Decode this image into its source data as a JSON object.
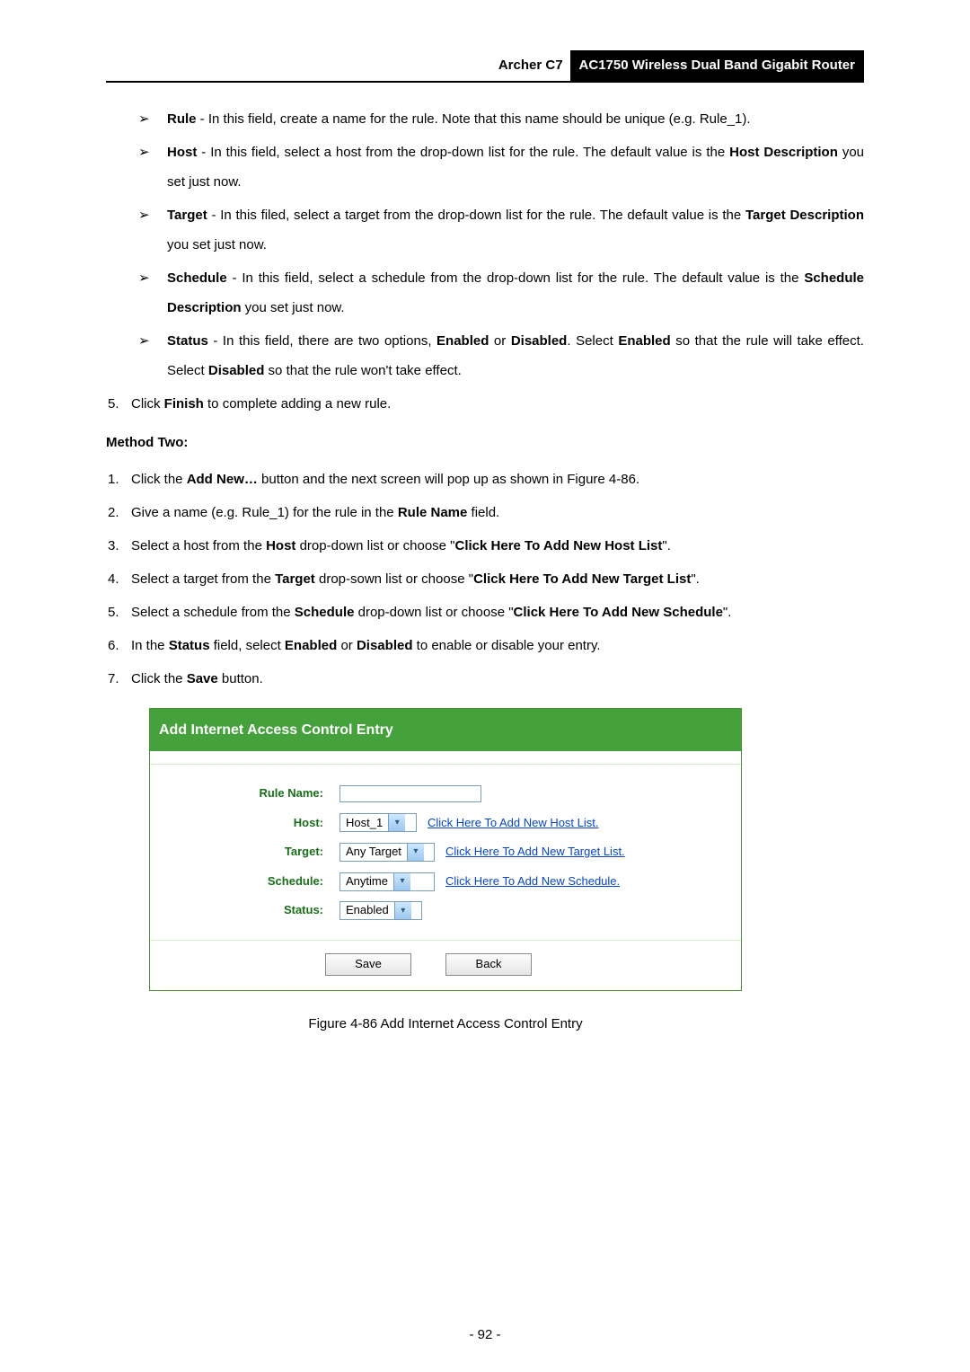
{
  "header": {
    "model": "Archer C7",
    "product": "AC1750 Wireless Dual Band Gigabit Router"
  },
  "bullets": {
    "rule_prefix": "Rule",
    "rule_rest": " - In this field, create a name for the rule. Note that this name should be unique (e.g. Rule_1).",
    "host_prefix": "Host",
    "host_mid1": " - In this field, select a host from the drop-down list for the rule. The default value is the ",
    "host_bold": "Host Description",
    "host_end": " you set just now.",
    "target_prefix": "Target",
    "target_mid1": " - In this filed, select a target from the drop-down list for the rule. The default value is the ",
    "target_bold": "Target Description",
    "target_end": " you set just now.",
    "schedule_prefix": "Schedule",
    "schedule_mid1": " - In this field, select a schedule from the drop-down list for the rule. The default value is the ",
    "schedule_bold": "Schedule Description",
    "schedule_end": " you set just now.",
    "status_prefix": "Status",
    "status_mid1": " - In this field, there are two options, ",
    "status_b1": "Enabled",
    "status_or": " or ",
    "status_b2": "Disabled",
    "status_mid2": ". Select ",
    "status_b3": "Enabled",
    "status_mid3": " so that the rule will take effect. Select ",
    "status_b4": "Disabled",
    "status_end": " so that the rule won't take effect."
  },
  "step5": {
    "num": "5.",
    "pre": "Click ",
    "bold": "Finish",
    "post": " to complete adding a new rule."
  },
  "method_two": "Method Two:",
  "m2_steps": {
    "s1_num": "1.",
    "s1_pre": "Click the ",
    "s1_bold": "Add New…",
    "s1_post": " button and the next screen will pop up as shown in Figure 4-86.",
    "s2_num": "2.",
    "s2_pre": "Give a name (e.g. Rule_1) for the rule in the ",
    "s2_bold": "Rule Name",
    "s2_post": " field.",
    "s3_num": "3.",
    "s3_pre": "Select a host from the ",
    "s3_bold": "Host",
    "s3_mid": " drop-down list or choose \"",
    "s3_bold2": "Click Here To Add New Host List",
    "s3_post": "\".",
    "s4_num": "4.",
    "s4_pre": "Select a target from the ",
    "s4_bold": "Target",
    "s4_mid": " drop-sown list or choose \"",
    "s4_bold2": "Click Here To Add New Target List",
    "s4_post": "\".",
    "s5_num": "5.",
    "s5_pre": "Select a schedule from the ",
    "s5_bold": "Schedule",
    "s5_mid": " drop-down list or choose \"",
    "s5_bold2": "Click Here To Add New Schedule",
    "s5_post": "\".",
    "s6_num": "6.",
    "s6_pre": "In the ",
    "s6_bold": "Status",
    "s6_mid": " field, select ",
    "s6_b1": "Enabled",
    "s6_or": " or ",
    "s6_b2": "Disabled",
    "s6_post": " to enable or disable your entry.",
    "s7_num": "7.",
    "s7_pre": "Click the ",
    "s7_bold": "Save",
    "s7_post": " button."
  },
  "figure": {
    "title": "Add Internet Access Control Entry",
    "labels": {
      "rule_name": "Rule Name:",
      "host": "Host:",
      "target": "Target:",
      "schedule": "Schedule:",
      "status": "Status:"
    },
    "values": {
      "rule_name": "",
      "host": "Host_1",
      "target": "Any Target",
      "schedule": "Anytime",
      "status": "Enabled"
    },
    "links": {
      "host": "Click Here To Add New Host List.",
      "target": "Click Here To Add New Target List.",
      "schedule": "Click Here To Add New Schedule."
    },
    "buttons": {
      "save": "Save",
      "back": "Back"
    },
    "caption": "Figure 4-86 Add Internet Access Control Entry"
  },
  "page_number": "- 92 -"
}
